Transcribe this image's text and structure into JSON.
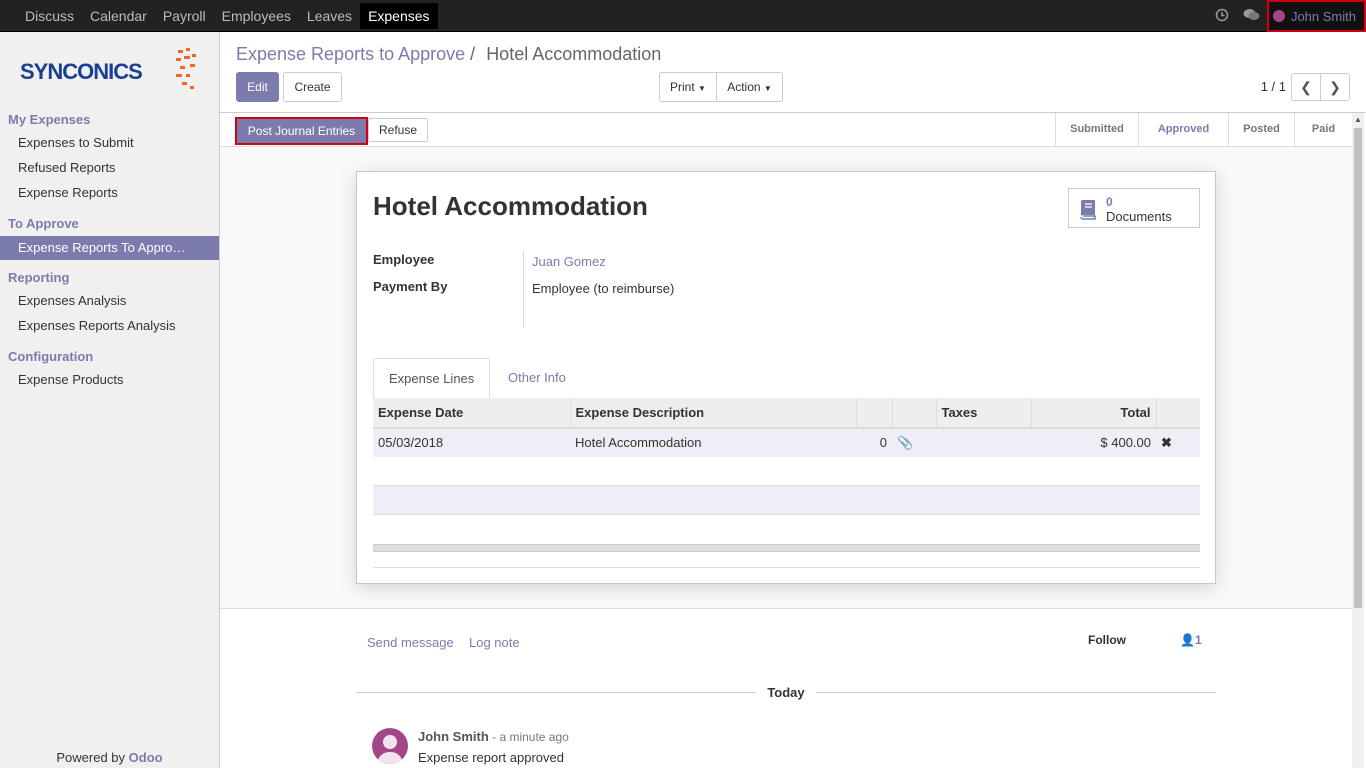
{
  "topbar": {
    "menu": [
      "Discuss",
      "Calendar",
      "Payroll",
      "Employees",
      "Leaves",
      "Expenses"
    ],
    "active_menu": "Expenses",
    "activity_icon": "clock-icon",
    "chat_icon": "chat-icon",
    "user_name": "John Smith"
  },
  "sidebar": {
    "logo_text": "SYNCONICS",
    "sections": [
      {
        "header": "My Expenses",
        "items": [
          "Expenses to Submit",
          "Refused Reports",
          "Expense Reports"
        ]
      },
      {
        "header": "To Approve",
        "items": [
          "Expense Reports To Appro…"
        ]
      },
      {
        "header": "Reporting",
        "items": [
          "Expenses Analysis",
          "Expenses Reports Analysis"
        ]
      },
      {
        "header": "Configuration",
        "items": [
          "Expense Products"
        ]
      }
    ],
    "powered_by": "Powered by",
    "powered_brand": "Odoo"
  },
  "control_panel": {
    "breadcrumb_parent": "Expense Reports to Approve",
    "breadcrumb_sep": "/",
    "breadcrumb_current": "Hotel Accommodation",
    "edit_label": "Edit",
    "create_label": "Create",
    "print_label": "Print",
    "action_label": "Action",
    "pager": "1 / 1"
  },
  "statusbar": {
    "post_label": "Post Journal Entries",
    "refuse_label": "Refuse",
    "stages": [
      "Submitted",
      "Approved",
      "Posted",
      "Paid"
    ],
    "active_stage": "Approved"
  },
  "form": {
    "title": "Hotel Accommodation",
    "documents_count": "0",
    "documents_label": "Documents",
    "employee_label": "Employee",
    "employee_value": "Juan Gomez",
    "payment_label": "Payment By",
    "payment_value": "Employee (to reimburse)",
    "tabs": [
      "Expense Lines",
      "Other Info"
    ],
    "table": {
      "headers": [
        "Expense Date",
        "Expense Description",
        "",
        "",
        "Taxes",
        "Total",
        ""
      ],
      "rows": [
        {
          "date": "05/03/2018",
          "description": "Hotel Accommodation",
          "attachments": "0",
          "taxes": "",
          "total": "$ 400.00"
        }
      ]
    }
  },
  "chatter": {
    "send_message": "Send message",
    "log_note": "Log note",
    "follow": "Follow",
    "followers": "1",
    "date_separator": "Today",
    "message": {
      "author": "John Smith",
      "date": " - a minute ago",
      "body": "Expense report approved"
    }
  },
  "colors": {
    "accent": "#7c7bad",
    "topbar": "#222222",
    "highlight_border": "#d00012",
    "avatar": "#a24689"
  }
}
